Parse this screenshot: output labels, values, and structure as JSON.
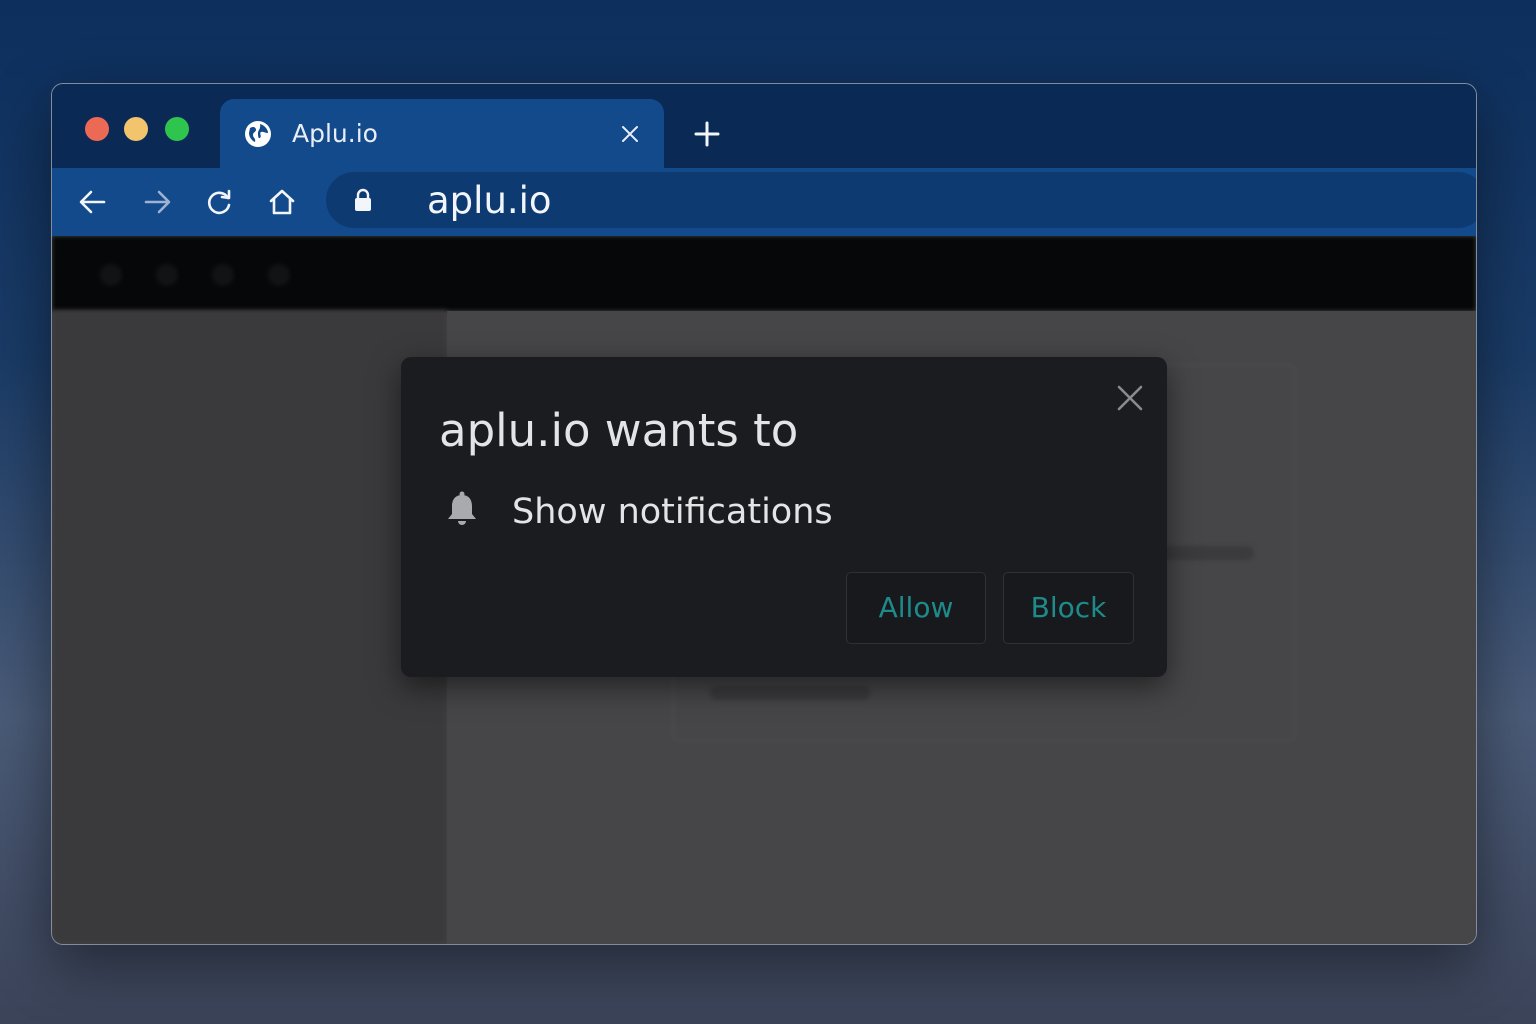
{
  "browser": {
    "tab": {
      "title": "Aplu.io",
      "favicon": "globe-icon"
    },
    "toolbar": {
      "back_icon": "arrow-left-icon",
      "forward_icon": "arrow-right-icon",
      "reload_icon": "reload-icon",
      "home_icon": "home-icon",
      "lock_icon": "lock-icon",
      "url": "aplu.io"
    },
    "colors": {
      "chrome_dark": "#0a2a55",
      "chrome_accent": "#134a8c",
      "traffic_red": "#ec6a55",
      "traffic_yellow": "#f2c46d",
      "traffic_green": "#2fc44e"
    }
  },
  "dialog": {
    "title": "aplu.io wants to",
    "permission_icon": "bell-icon",
    "permission_text": "Show notifications",
    "allow_label": "Allow",
    "block_label": "Block",
    "button_text_color": "#1e8a8a"
  }
}
